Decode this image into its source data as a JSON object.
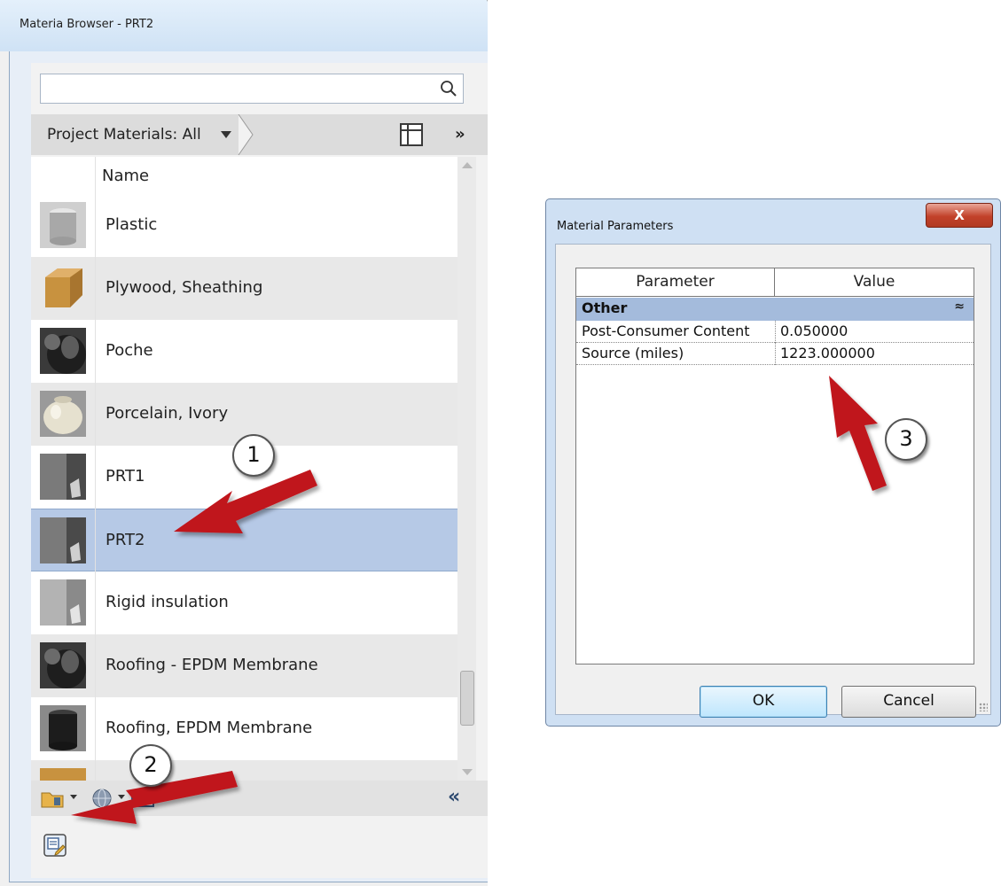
{
  "browser": {
    "title": "Materia Browser - PRT2",
    "search": {
      "value": "",
      "placeholder": ""
    },
    "filter": {
      "label": "Project Materials: All"
    },
    "more_label": "»",
    "list": {
      "column_name": "Name",
      "items": [
        {
          "name": "Plastic",
          "thumbnail": "cylinder-gray"
        },
        {
          "name": "Plywood, Sheathing",
          "thumbnail": "cube-wood"
        },
        {
          "name": "Poche",
          "thumbnail": "sphere-black"
        },
        {
          "name": "Porcelain, Ivory",
          "thumbnail": "vase-ivory"
        },
        {
          "name": "PRT1",
          "thumbnail": "wall-gray"
        },
        {
          "name": "PRT2",
          "thumbnail": "wall-gray",
          "selected": true
        },
        {
          "name": "Rigid insulation",
          "thumbnail": "wall-gray-light"
        },
        {
          "name": "Roofing - EPDM Membrane",
          "thumbnail": "sphere-black"
        },
        {
          "name": "Roofing, EPDM Membrane",
          "thumbnail": "cylinder-black"
        }
      ]
    },
    "collapse_label": "«",
    "toolbar_icons": [
      "folder-settings-icon",
      "globe-icon",
      "list-icon"
    ],
    "edit_icon": "edit-material-icon"
  },
  "dialog": {
    "title": "Material Parameters",
    "close_label": "X",
    "columns": {
      "parameter": "Parameter",
      "value": "Value"
    },
    "group": {
      "name": "Other",
      "toggle": "≈"
    },
    "params": [
      {
        "name": "Post-Consumer Content",
        "value": "0.050000"
      },
      {
        "name": "Source (miles)",
        "value": "1223.000000"
      }
    ],
    "ok_label": "OK",
    "cancel_label": "Cancel"
  },
  "annotations": [
    {
      "label": "1",
      "color": "#c0141c"
    },
    {
      "label": "2",
      "color": "#c0141c"
    },
    {
      "label": "3",
      "color": "#c0141c"
    }
  ],
  "colors": {
    "selection": "#b6c9e6",
    "group_header": "#a4bbdc",
    "arrow": "#c0141c"
  }
}
